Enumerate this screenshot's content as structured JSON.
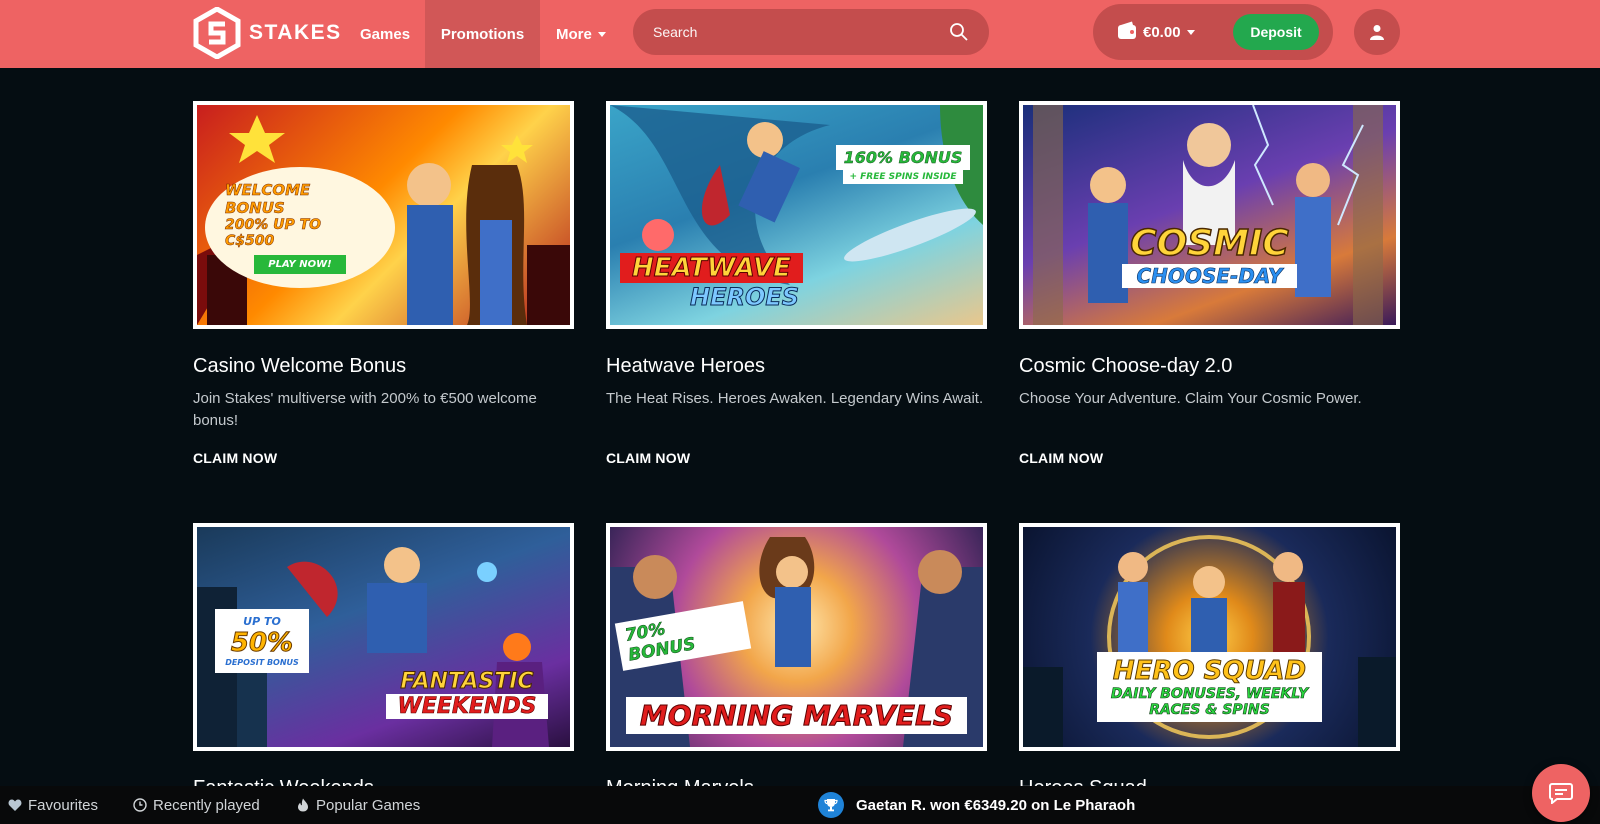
{
  "header": {
    "brand": "STAKES",
    "nav": {
      "games": "Games",
      "promotions": "Promotions",
      "more": "More"
    },
    "search_placeholder": "Search",
    "balance": "€0.00",
    "deposit_label": "Deposit"
  },
  "promotions": [
    {
      "title": "Casino Welcome Bonus",
      "description": "Join Stakes' multiverse with 200% to €500 welcome bonus!",
      "cta": "CLAIM NOW",
      "banner": [
        "WELCOME BONUS",
        "200% UP TO C$500",
        "PLAY NOW!"
      ]
    },
    {
      "title": "Heatwave Heroes",
      "description": "The Heat Rises. Heroes Awaken. Legendary Wins Await.",
      "cta": "CLAIM NOW",
      "banner": [
        "160% BONUS",
        "+ FREE SPINS INSIDE",
        "HEATWAVE",
        "HEROES"
      ]
    },
    {
      "title": "Cosmic Choose-day 2.0",
      "description": "Choose Your Adventure. Claim Your Cosmic Power.",
      "cta": "CLAIM NOW",
      "banner": [
        "COSMIC",
        "CHOOSE-DAY"
      ]
    },
    {
      "title": "Fantastic Weekends",
      "banner": [
        "UP TO",
        "50%",
        "DEPOSIT BONUS",
        "FANTASTIC",
        "WEEKENDS"
      ]
    },
    {
      "title": "Morning Marvels",
      "banner": [
        "70% BONUS",
        "MORNING MARVELS"
      ]
    },
    {
      "title": "Heroes Squad",
      "banner": [
        "HERO SQUAD",
        "DAILY BONUSES, WEEKLY",
        "RACES & SPINS"
      ]
    }
  ],
  "bottom_bar": {
    "favourites": "Favourites",
    "recently_played": "Recently played",
    "popular_games": "Popular Games",
    "winner_ticker": "Gaetan R. won €6349.20 on Le Pharaoh"
  },
  "colors": {
    "brand": "#ee6363",
    "deposit": "#23a84e",
    "background": "#050d12"
  },
  "icons": [
    "stakes-logo-icon",
    "search-icon",
    "wallet-icon",
    "user-icon",
    "heart-icon",
    "clock-icon",
    "flame-icon",
    "trophy-icon",
    "chat-icon"
  ]
}
